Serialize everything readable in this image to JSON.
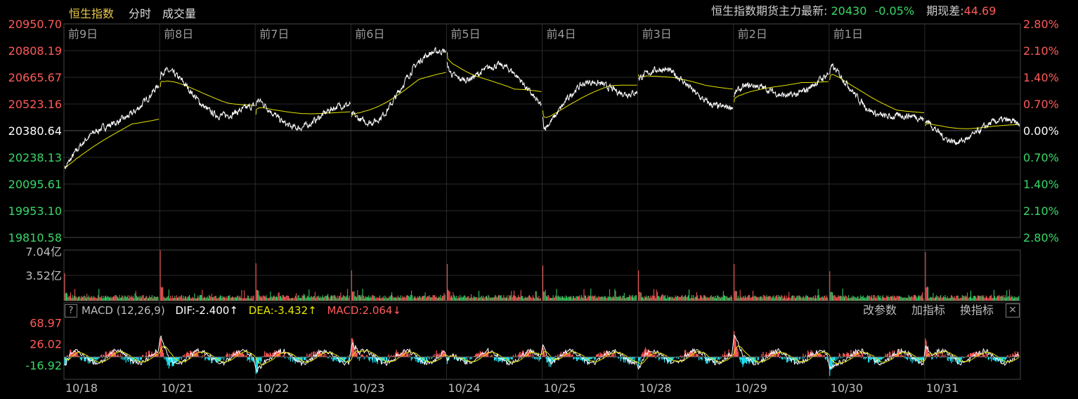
{
  "header": {
    "tabs": [
      "恒生指数",
      "分时",
      "成交量"
    ],
    "futures_label": "恒生指数期货主力最新:",
    "futures_price": "20430",
    "futures_change": "-0.05%",
    "basis_label": "期现差:",
    "basis_value": "44.69"
  },
  "macd": {
    "help": "?",
    "label": "MACD (12,26,9)",
    "dif": "DIF:-2.400↑",
    "dea": "DEA:-3.432↑",
    "macd": "MACD:2.064↓",
    "buttons": [
      "改参数",
      "加指标",
      "换指标"
    ],
    "close": "×"
  },
  "colors": {
    "up": "#ff5a5a",
    "down": "#38d86a",
    "flat": "#ffffff",
    "cyan": "#22e0f0",
    "yellow": "#e6e600",
    "grid": "#2a2a2a",
    "border": "#444444"
  },
  "chart_data": [
    {
      "type": "line",
      "name": "price",
      "days": [
        "前9日",
        "前8日",
        "前7日",
        "前6日",
        "前5日",
        "前4日",
        "前3日",
        "前2日",
        "前1日",
        ""
      ],
      "x_dates": [
        "10/18",
        "10/21",
        "10/22",
        "10/23",
        "10/24",
        "10/25",
        "10/28",
        "10/29",
        "10/30",
        "10/31"
      ],
      "ylim": [
        19810.58,
        20950.7
      ],
      "prev_close": 20380.64,
      "y_ticks": [
        "20950.70",
        "20808.19",
        "20665.67",
        "20523.16",
        "20380.64",
        "20238.13",
        "20095.61",
        "19953.10",
        "19810.58"
      ],
      "pct_ticks": [
        "2.80%",
        "2.10%",
        "1.40%",
        "0.70%",
        "0.00%",
        "0.70%",
        "1.40%",
        "2.10%",
        "2.80%"
      ],
      "price_close_by_day": [
        20640,
        20480,
        20470,
        20780,
        20540,
        20640,
        20530,
        20670,
        20400,
        20380
      ],
      "avg_line_end_by_day": [
        20470,
        20480,
        20500,
        20780,
        20510,
        20680,
        20590,
        20680,
        20430,
        20440
      ]
    },
    {
      "type": "bar",
      "name": "volume",
      "y_ticks": [
        "7.04亿",
        "3.52亿"
      ],
      "ylim": [
        0,
        7.04
      ],
      "peaks_by_day": [
        3.8,
        7.0,
        5.2,
        4.2,
        5.1,
        4.9,
        4.2,
        5.1,
        4.1,
        6.8
      ],
      "unit": "亿"
    },
    {
      "type": "bar",
      "name": "macd",
      "y_ticks": [
        "68.97",
        "26.02",
        "-16.92"
      ],
      "ylim": [
        -45,
        75
      ]
    }
  ]
}
